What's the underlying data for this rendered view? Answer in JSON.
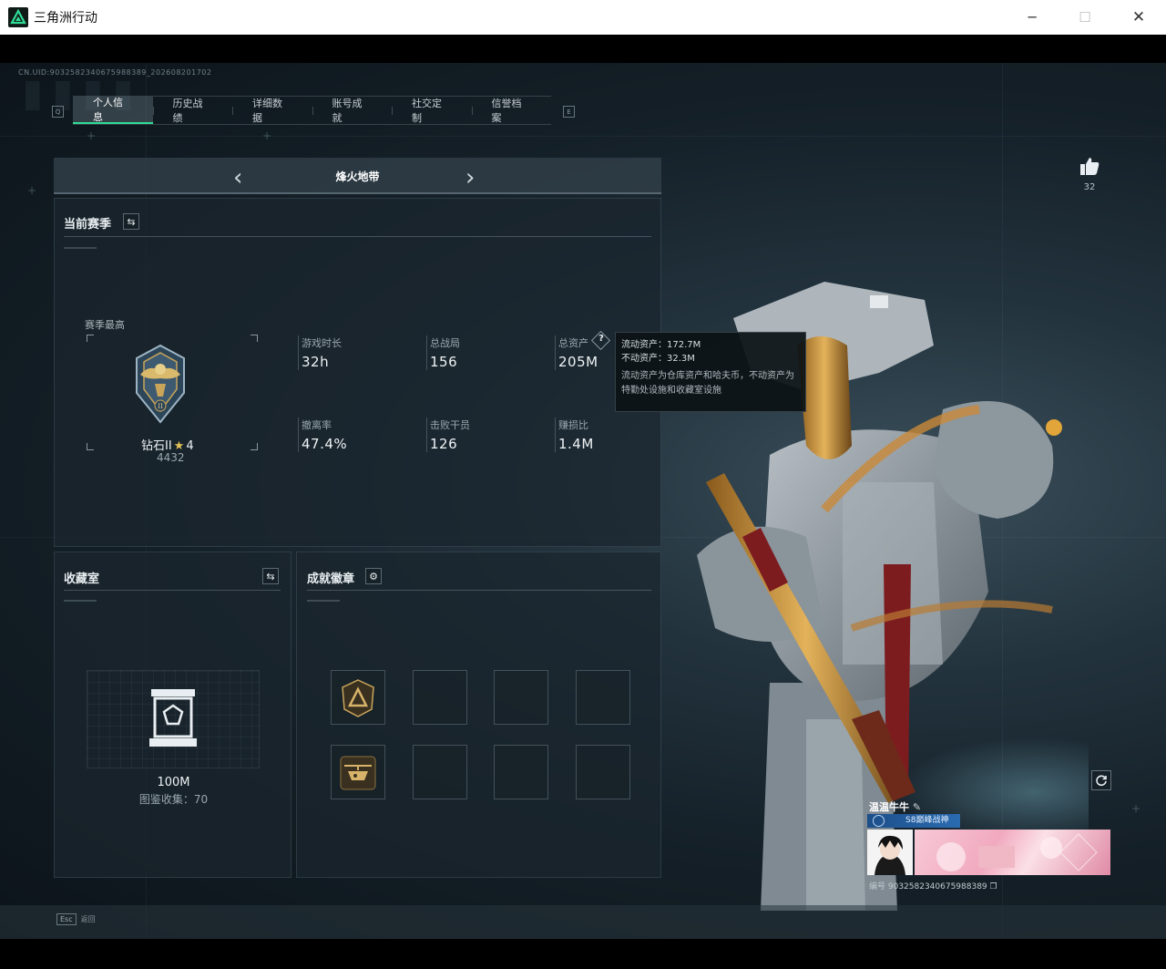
{
  "window": {
    "title": "三角洲行动",
    "minimize": "─",
    "maximize": "☐",
    "close": "✕"
  },
  "uid_line": "CN.UID:903258234067598838​9_202608201702",
  "tabs": [
    "个人信息",
    "历史战绩",
    "详细数据",
    "账号成就",
    "社交定制",
    "信誉档案"
  ],
  "tab_keys": {
    "prev": "Q",
    "next": "E"
  },
  "mode": "烽火地带",
  "season": {
    "title": "当前赛季",
    "best_label": "赛季最高",
    "rank_name": "钻石II",
    "rank_star": "★",
    "rank_stars": "4",
    "rank_points": "4432",
    "stats": [
      {
        "label": "游戏时长",
        "value": "32h"
      },
      {
        "label": "总战局",
        "value": "156"
      },
      {
        "label": "总资产",
        "value": "205M"
      },
      {
        "label": "撤离率",
        "value": "47.4%"
      },
      {
        "label": "击败干员",
        "value": "126"
      },
      {
        "label": "赚损比",
        "value": "1.4M"
      }
    ]
  },
  "tooltip": {
    "line1": "流动资产：172.7M",
    "line2": "不动资产：32.3M",
    "line3": "流动资产为仓库资产和哈夫币，不动资产为特勤处设施和收藏室设施"
  },
  "collection": {
    "title": "收藏室",
    "value": "100M",
    "sub": "图鉴收集：70"
  },
  "badges": {
    "title": "成就徽章"
  },
  "likes": "32",
  "player": {
    "name": "温温牛牛",
    "rank_title": "S8巅峰战神",
    "uid": "编号 903258234067598838​9"
  },
  "footer": {
    "esc_key": "Esc",
    "esc_label": "返回"
  },
  "colors": {
    "accent": "#2fdc96",
    "gold": "#d4a84a"
  }
}
